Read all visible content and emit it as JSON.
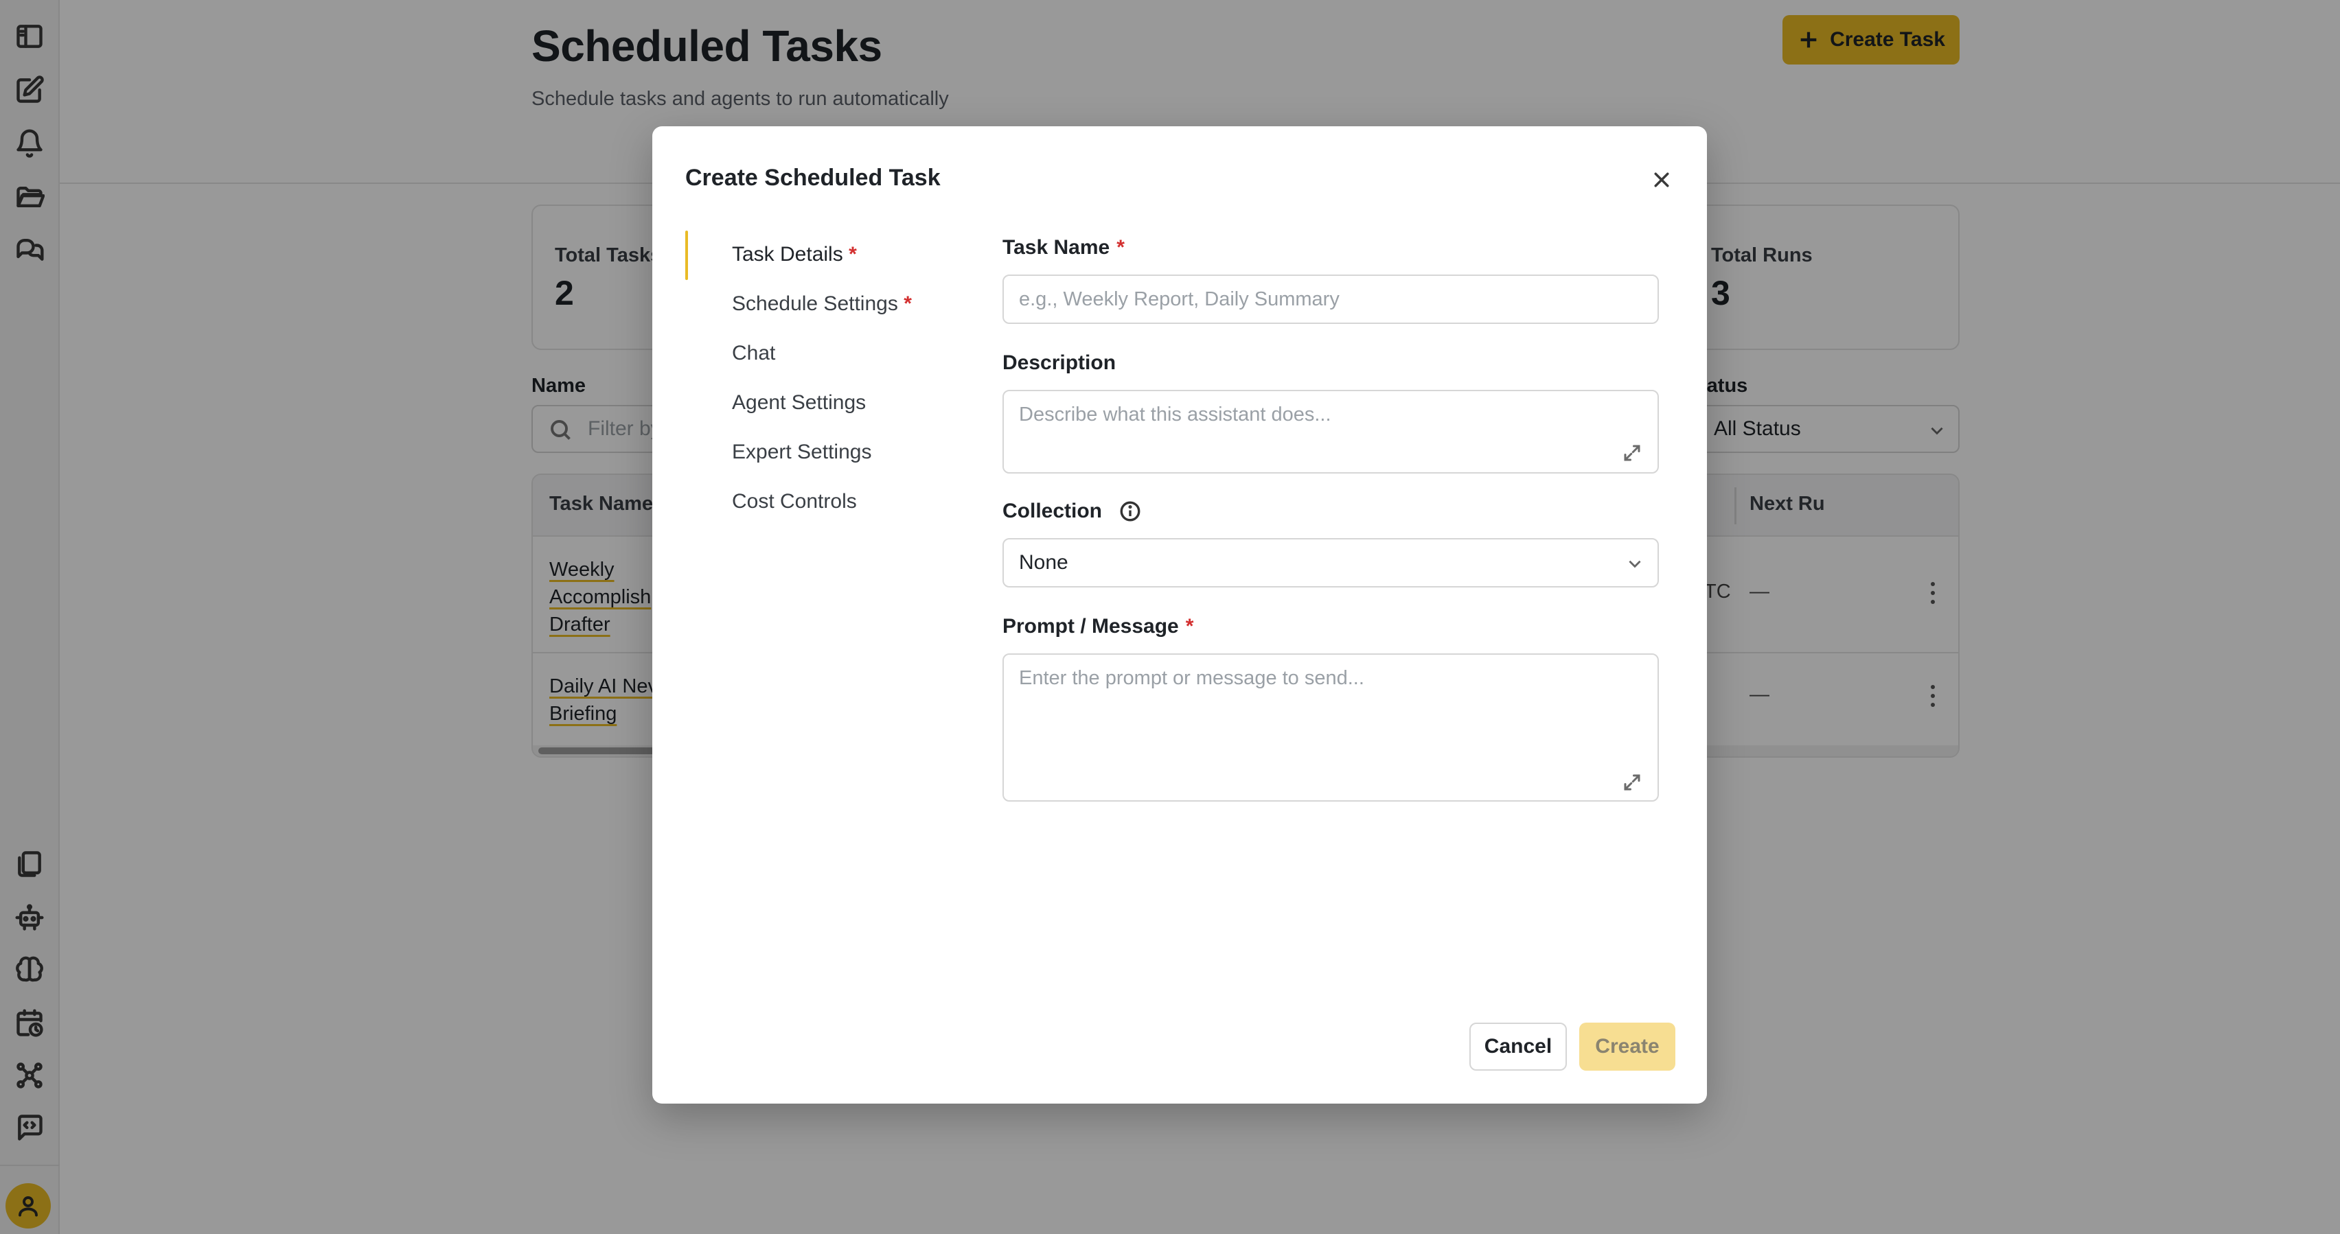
{
  "page": {
    "title": "Scheduled Tasks",
    "subtitle": "Schedule tasks and agents to run automatically",
    "create_button": "Create Task"
  },
  "sidebar": {
    "top_icons": [
      "sidebar-toggle-icon",
      "compose-icon",
      "bell-icon",
      "folder-icon",
      "chat-bubbles-icon"
    ],
    "bottom_icons": [
      "documents-icon",
      "robot-icon",
      "brain-icon",
      "calendar-clock-icon",
      "network-icon",
      "code-bubble-icon"
    ],
    "avatar_icon": "user-icon"
  },
  "stats": [
    {
      "label": "Total Tasks",
      "value": "2"
    },
    {
      "label": "Total Runs",
      "value": "3"
    }
  ],
  "filters": {
    "name_label": "Name",
    "name_placeholder": "Filter by",
    "status_label": "tatus",
    "status_value": "All Status"
  },
  "table": {
    "columns": [
      "Task Name",
      "Next Ru"
    ],
    "rows": [
      {
        "name_lines": [
          "Weekly",
          "Accomplish",
          "Drafter"
        ],
        "partial": "TC",
        "next_run": "—"
      },
      {
        "name_lines": [
          "Daily AI Nev",
          "Briefing"
        ],
        "partial": "",
        "next_run": "—"
      }
    ]
  },
  "modal": {
    "title": "Create Scheduled Task",
    "nav": [
      {
        "label": "Task Details",
        "required": true,
        "active": true
      },
      {
        "label": "Schedule Settings",
        "required": true,
        "active": false
      },
      {
        "label": "Chat",
        "required": false,
        "active": false
      },
      {
        "label": "Agent Settings",
        "required": false,
        "active": false
      },
      {
        "label": "Expert Settings",
        "required": false,
        "active": false
      },
      {
        "label": "Cost Controls",
        "required": false,
        "active": false
      }
    ],
    "required_mark": "*",
    "fields": {
      "task_name_label": "Task Name",
      "task_name_placeholder": "e.g., Weekly Report, Daily Summary",
      "description_label": "Description",
      "description_placeholder": "Describe what this assistant does...",
      "collection_label": "Collection",
      "collection_value": "None",
      "prompt_label": "Prompt / Message",
      "prompt_placeholder": "Enter the prompt or message to send..."
    },
    "cancel_label": "Cancel",
    "create_label": "Create"
  },
  "colors": {
    "accent": "#e9bb26",
    "accent_disabled": "#f7de92",
    "required": "#d32f2f"
  }
}
